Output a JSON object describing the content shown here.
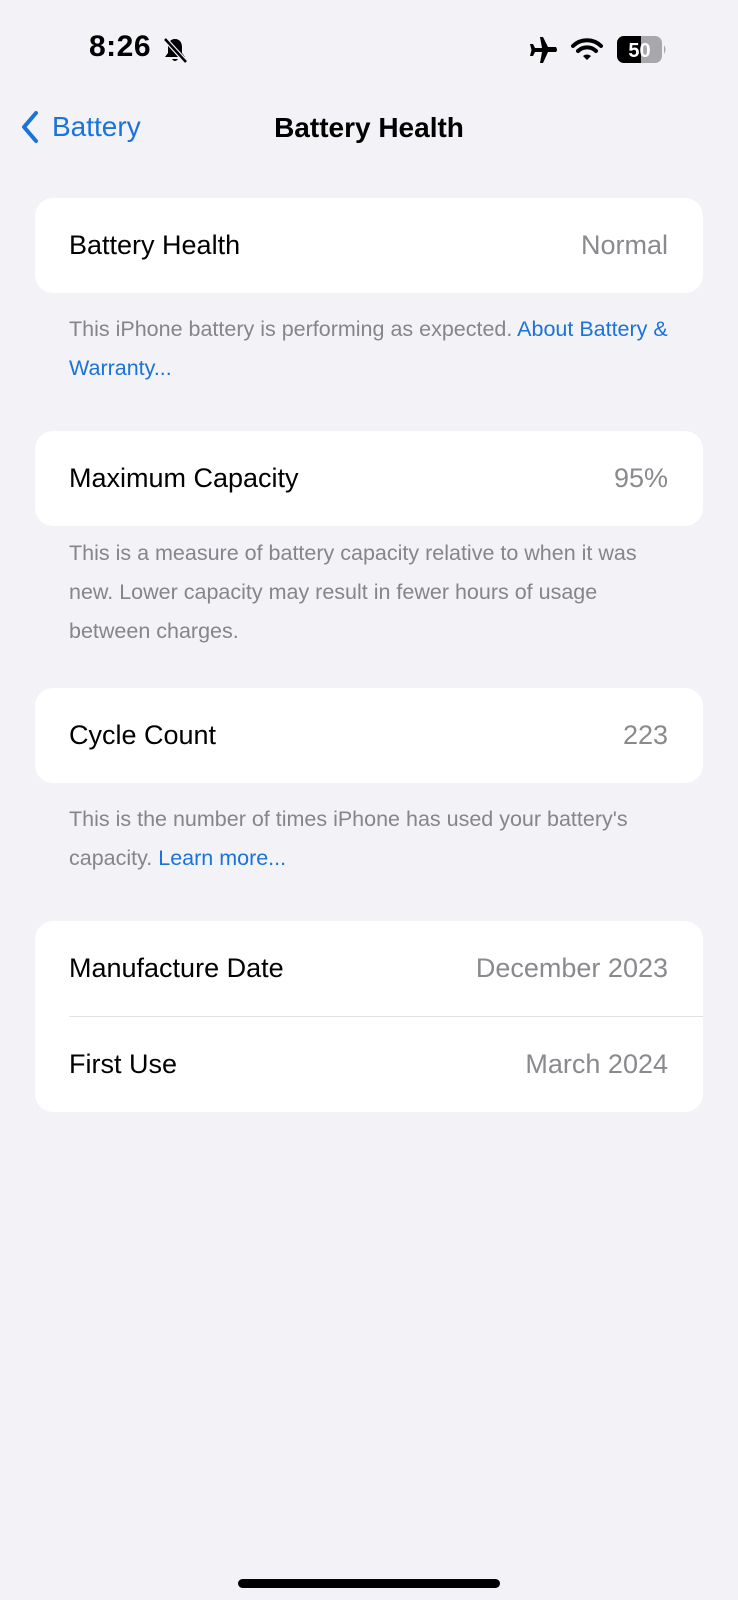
{
  "status_bar": {
    "time": "8:26",
    "silent_mode_icon": "bell-slash-icon",
    "airplane_icon": "airplane-icon",
    "wifi_icon": "wifi-icon",
    "battery_level": "50",
    "battery_fraction": 0.5
  },
  "nav": {
    "back_label": "Battery",
    "title": "Battery Health"
  },
  "sections": {
    "health": {
      "label": "Battery Health",
      "value": "Normal",
      "footnote_text": "This iPhone battery is performing as expected. ",
      "footnote_link": "About Battery & Warranty..."
    },
    "capacity": {
      "label": "Maximum Capacity",
      "value": "95%",
      "footnote_text": "This is a measure of battery capacity relative to when it was new. Lower capacity may result in fewer hours of usage between charges."
    },
    "cycles": {
      "label": "Cycle Count",
      "value": "223",
      "footnote_text": "This is the number of times iPhone has used your battery's capacity. ",
      "footnote_link": "Learn more..."
    },
    "dates": {
      "manufacture_label": "Manufacture Date",
      "manufacture_value": "December 2023",
      "first_use_label": "First Use",
      "first_use_value": "March 2024"
    }
  },
  "colors": {
    "accent": "#1a73d9",
    "background": "#f2f2f7",
    "secondary_text": "#8a8a8e"
  }
}
